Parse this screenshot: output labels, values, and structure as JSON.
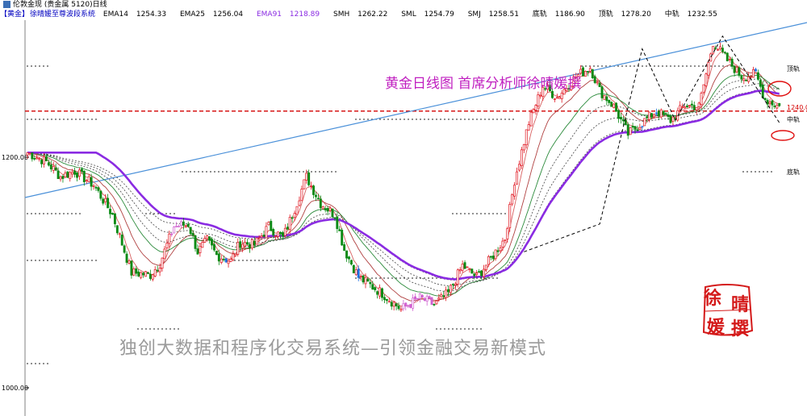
{
  "window": {
    "title": "伦敦金现 (贵金属 5120)日线"
  },
  "infobar": {
    "symbol": "【黄金】",
    "system": "徐晴媛至尊波段系统",
    "items": [
      {
        "label": "EMA14",
        "value": "1254.33",
        "color": "#000000"
      },
      {
        "label": "EMA25",
        "value": "1256.04",
        "color": "#000000"
      },
      {
        "label": "EMA91",
        "value": "1218.89",
        "color": "#8a2be2"
      },
      {
        "label": "SMH",
        "value": "1262.22",
        "color": "#000000"
      },
      {
        "label": "SML",
        "value": "1254.79",
        "color": "#000000"
      },
      {
        "label": "SMJ",
        "value": "1258.51",
        "color": "#000000"
      },
      {
        "label": "底轨",
        "value": "1186.90",
        "color": "#000000"
      },
      {
        "label": "顶轨",
        "value": "1278.20",
        "color": "#000000"
      },
      {
        "label": "中轨",
        "value": "1232.55",
        "color": "#000000"
      }
    ]
  },
  "headline": "黄金日线图 首席分析师徐晴媛撰",
  "slogan": "独创大数据和程序化交易系统—引领金融交易新模式",
  "seal": {
    "chars": [
      "徐",
      "晴",
      "媛",
      "撰"
    ],
    "color": "#d41a1a"
  },
  "chart_data": {
    "type": "candlestick",
    "y_ticks": [
      "1200.00",
      "1000.00"
    ],
    "price_label": "1240.00",
    "band_labels": {
      "top": "顶轨",
      "mid": "中轨",
      "bottom": "底轨"
    },
    "reference_lines": {
      "top": 1278.2,
      "mid": 1232.55,
      "bottom": 1186.9,
      "price": 1240.0
    },
    "colors": {
      "up": "#e0141e",
      "down": "#0a8a14",
      "up_alt": "#d060d0",
      "down_alt": "#1e6fe0",
      "ema91": "#8a2be2",
      "trendline": "#4a90d9",
      "price_line": "#d40000"
    },
    "anchors": [
      [
        0,
        1204
      ],
      [
        8,
        1196
      ],
      [
        14,
        1183
      ],
      [
        20,
        1188
      ],
      [
        28,
        1176
      ],
      [
        36,
        1150
      ],
      [
        44,
        1100
      ],
      [
        52,
        1098
      ],
      [
        56,
        1108
      ],
      [
        62,
        1140
      ],
      [
        68,
        1142
      ],
      [
        72,
        1118
      ],
      [
        76,
        1128
      ],
      [
        80,
        1115
      ],
      [
        86,
        1110
      ],
      [
        90,
        1126
      ],
      [
        96,
        1124
      ],
      [
        102,
        1140
      ],
      [
        108,
        1130
      ],
      [
        112,
        1150
      ],
      [
        118,
        1183
      ],
      [
        124,
        1160
      ],
      [
        130,
        1150
      ],
      [
        134,
        1120
      ],
      [
        140,
        1096
      ],
      [
        150,
        1082
      ],
      [
        158,
        1068
      ],
      [
        166,
        1078
      ],
      [
        172,
        1072
      ],
      [
        178,
        1082
      ],
      [
        184,
        1106
      ],
      [
        190,
        1096
      ],
      [
        196,
        1112
      ],
      [
        202,
        1130
      ],
      [
        206,
        1180
      ],
      [
        212,
        1230
      ],
      [
        218,
        1262
      ],
      [
        224,
        1252
      ],
      [
        232,
        1270
      ],
      [
        238,
        1278
      ],
      [
        242,
        1258
      ],
      [
        248,
        1244
      ],
      [
        254,
        1220
      ],
      [
        260,
        1230
      ],
      [
        266,
        1240
      ],
      [
        272,
        1232
      ],
      [
        278,
        1245
      ],
      [
        284,
        1244
      ],
      [
        290,
        1300
      ],
      [
        296,
        1284
      ],
      [
        302,
        1270
      ],
      [
        308,
        1272
      ],
      [
        312,
        1250
      ],
      [
        318,
        1244
      ]
    ]
  }
}
